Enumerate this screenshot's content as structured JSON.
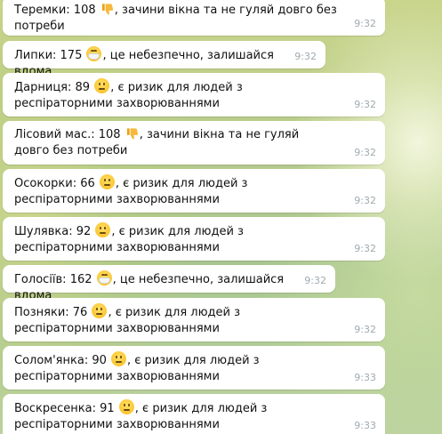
{
  "messages": [
    {
      "text": "Теремки: 108 ",
      "emoji": "thumbs-down-icon",
      "rest": ", зачини вікна та не гуляй довго без потреби",
      "time": "9:32"
    },
    {
      "text": "Липки: 175 ",
      "emoji": "mask-face-icon",
      "rest": ", це небезпечно, залишайся вдома",
      "time": "9:32"
    },
    {
      "text": "Дарниця: 89 ",
      "emoji": "neutral-face-icon",
      "rest": ", є ризик для людей з респіраторними захворюваннями",
      "time": "9:32"
    },
    {
      "text": "Лісовий мас.: 108 ",
      "emoji": "thumbs-down-icon",
      "rest": ", зачини вікна та не гуляй довго без потреби",
      "time": "9:32"
    },
    {
      "text": "Осокорки: 66 ",
      "emoji": "neutral-face-icon",
      "rest": ", є ризик для людей з респіраторними захворюваннями",
      "time": "9:32"
    },
    {
      "text": "Шулявка: 92 ",
      "emoji": "neutral-face-icon",
      "rest": ", є ризик для людей з респіраторними захворюваннями",
      "time": "9:32"
    },
    {
      "text": "Голосіїв: 162 ",
      "emoji": "mask-face-icon",
      "rest": ", це небезпечно, залишайся вдома",
      "time": "9:32"
    },
    {
      "text": "Позняки: 76 ",
      "emoji": "neutral-face-icon",
      "rest": ", є ризик для людей з респіраторними захворюваннями",
      "time": "9:32"
    },
    {
      "text": "Солом'янка: 90 ",
      "emoji": "neutral-face-icon",
      "rest": ", є ризик для людей з респіраторними захворюваннями",
      "time": "9:33"
    },
    {
      "text": "Воскресенка: 91 ",
      "emoji": "neutral-face-icon",
      "rest": ", є ризик для людей з респіраторними захворюваннями",
      "time": "9:33"
    }
  ]
}
